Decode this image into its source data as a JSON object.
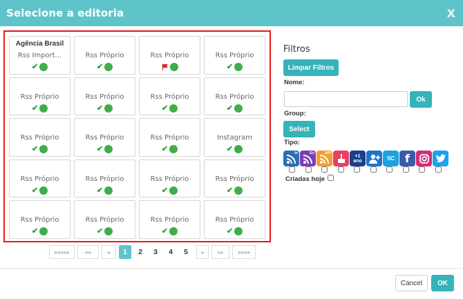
{
  "dialog": {
    "title": "Selecione a editoria",
    "close_label": "X"
  },
  "cards": [
    {
      "header": "Agência Brasil",
      "name": "Rss Import...",
      "status": "ok"
    },
    {
      "header": "",
      "name": "Rss Próprio",
      "status": "ok"
    },
    {
      "header": "",
      "name": "Rss Próprio",
      "status": "flag"
    },
    {
      "header": "",
      "name": "Rss Próprio",
      "status": "ok"
    },
    {
      "header": "",
      "name": "Rss Próprio",
      "status": "ok"
    },
    {
      "header": "",
      "name": "Rss Próprio",
      "status": "ok"
    },
    {
      "header": "",
      "name": "Rss Próprio",
      "status": "ok"
    },
    {
      "header": "",
      "name": "Rss Próprio",
      "status": "ok"
    },
    {
      "header": "",
      "name": "Rss Próprio",
      "status": "ok"
    },
    {
      "header": "",
      "name": "Rss Próprio",
      "status": "ok"
    },
    {
      "header": "",
      "name": "Rss Próprio",
      "status": "ok"
    },
    {
      "header": "",
      "name": "Instagram",
      "status": "ok"
    },
    {
      "header": "",
      "name": "Rss Próprio",
      "status": "ok"
    },
    {
      "header": "",
      "name": "Rss Próprio",
      "status": "ok"
    },
    {
      "header": "",
      "name": "Rss Próprio",
      "status": "ok"
    },
    {
      "header": "",
      "name": "Rss Próprio",
      "status": "ok"
    },
    {
      "header": "",
      "name": "Rss Próprio",
      "status": "ok"
    },
    {
      "header": "",
      "name": "Rss Próprio",
      "status": "ok"
    },
    {
      "header": "",
      "name": "Rss Próprio",
      "status": "ok"
    },
    {
      "header": "",
      "name": "Rss Próprio",
      "status": "ok"
    }
  ],
  "status_icons": {
    "ok": [
      "check-icon",
      "green-dot-icon"
    ],
    "flag": [
      "red-flag-icon",
      "green-dot-icon"
    ]
  },
  "pagination": {
    "first": "«««««",
    "prev_block": "««",
    "prev": "«",
    "pages": [
      "1",
      "2",
      "3",
      "4",
      "5"
    ],
    "active_page": "1",
    "next": "»",
    "next_block": "»»",
    "last": "»»»»"
  },
  "filters": {
    "title": "Filtros",
    "clear_label": "Limpar Filtros",
    "name_label": "Nome:",
    "name_value": "",
    "name_placeholder": "",
    "ok_label": "Ok",
    "group_label": "Group:",
    "select_label": "Select",
    "tipo_label": "Tipo:",
    "tipo_icons": [
      {
        "name": "rss-in-icon",
        "badge": "In",
        "color": "#2d6fb5"
      },
      {
        "name": "rss-ex-icon",
        "badge": "Ex",
        "color": "#7b3fb5"
      },
      {
        "name": "rss-api-icon",
        "badge": "API",
        "color": "#f0a030"
      },
      {
        "name": "birthday-cake-icon",
        "badge": "",
        "color": "#e84060"
      },
      {
        "name": "plus-one-year-icon",
        "badge": "+1 ano",
        "color": "#1a3f8c"
      },
      {
        "name": "add-user-icon",
        "badge": "",
        "color": "#1f75c9"
      },
      {
        "name": "sc-icon",
        "badge": "SC",
        "color": "#1aa3e0"
      },
      {
        "name": "facebook-icon",
        "badge": "f",
        "color": "#3b5bab"
      },
      {
        "name": "instagram-icon",
        "badge": "",
        "color": "#d62a7a"
      },
      {
        "name": "twitter-icon",
        "badge": "",
        "color": "#1da1f2"
      }
    ],
    "criadas_hoje_label": "Criadas hoje"
  },
  "footer": {
    "cancel_label": "Cancel",
    "ok_label": "OK"
  }
}
